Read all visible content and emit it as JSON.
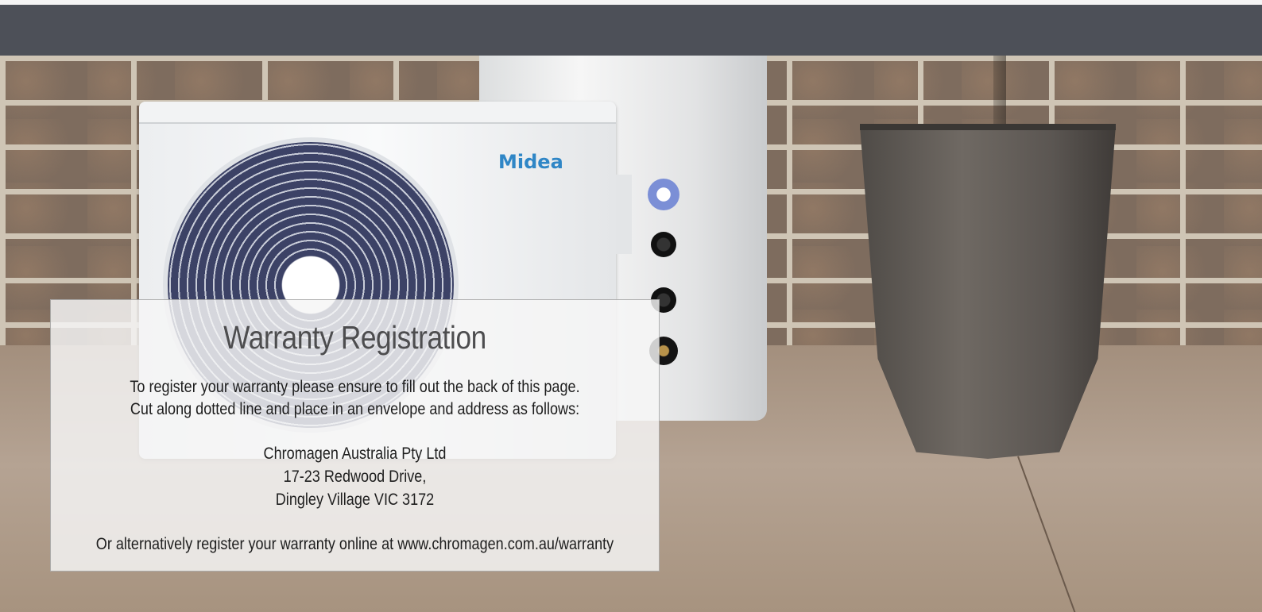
{
  "panel": {
    "title": "Warranty Registration",
    "intro_line1": "To register your warranty please ensure to fill out the back of this page.",
    "intro_line2": "Cut along dotted line and place in an envelope and address as follows:",
    "address_line1": "Chromagen Australia Pty Ltd",
    "address_line2": "17-23 Redwood Drive,",
    "address_line3": "Dingley Village VIC 3172",
    "online_text": "Or alternatively register your warranty online at www.chromagen.com.au/warranty"
  },
  "image": {
    "brand_logo_text": "Midea"
  },
  "colors": {
    "header_bar": "#4d5058",
    "logo_blue": "#2f86c6",
    "panel_bg": "#f5f5f5",
    "title_gray": "#4d4d4f"
  }
}
